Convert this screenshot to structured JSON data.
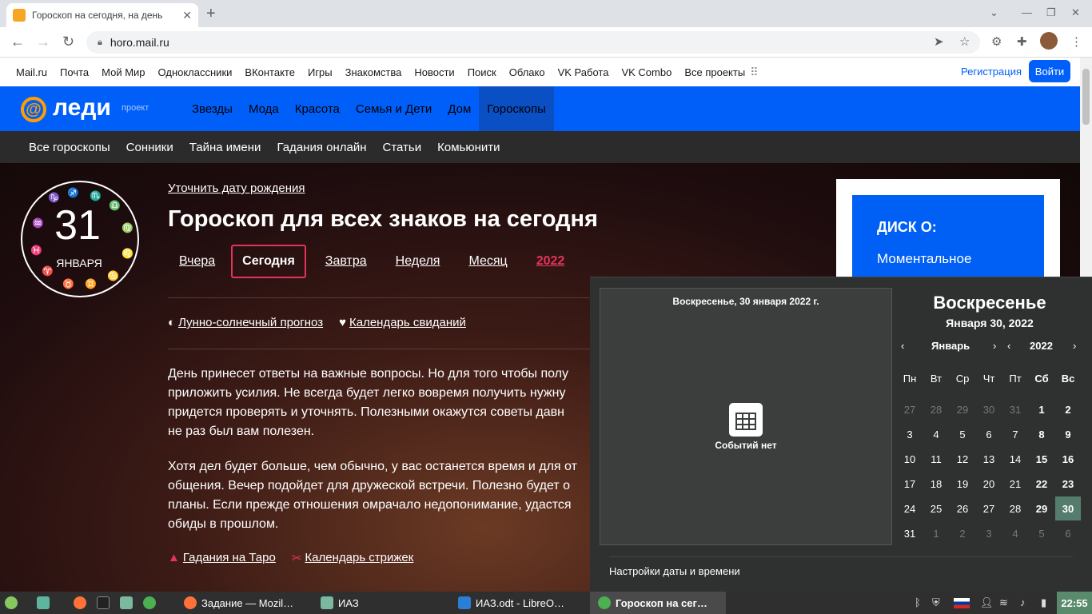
{
  "browser": {
    "tab_title": "Гороскоп на сегодня, на день",
    "url": "horo.mail.ru"
  },
  "portal": {
    "links": [
      "Mail.ru",
      "Почта",
      "Мой Мир",
      "Одноклассники",
      "ВКонтакте",
      "Игры",
      "Знакомства",
      "Новости",
      "Поиск",
      "Облако",
      "VK Работа",
      "VK Combo",
      "Все проекты"
    ],
    "register": "Регистрация",
    "login": "Войти"
  },
  "lady": {
    "logo_text": "леди",
    "logo_sub": "проект",
    "nav": [
      "Звезды",
      "Мода",
      "Красота",
      "Семья и Дети",
      "Дом",
      "Гороскопы"
    ],
    "subnav": [
      "Все гороскопы",
      "Сонники",
      "Тайна имени",
      "Гадания онлайн",
      "Статьи",
      "Комьюнити"
    ]
  },
  "dial": {
    "day": "31",
    "month": "ЯНВАРЯ",
    "zodiac": [
      "♑",
      "♐",
      "♏",
      "♎",
      "♍",
      "♌",
      "♋",
      "♊",
      "♉",
      "♈",
      "♓",
      "♒"
    ]
  },
  "content": {
    "refine_date": "Уточнить дату рождения",
    "title": "Гороскоп для всех знаков на сегодня",
    "periods": [
      "Вчера",
      "Сегодня",
      "Завтра",
      "Неделя",
      "Месяц",
      "2022"
    ],
    "moon_link": "Лунно-солнечный прогноз",
    "dates_link": "Календарь свиданий",
    "para1": "День принесет ответы на важные вопросы. Но для того чтобы полу\nприложить усилия. Не всегда будет легко вовремя получить нужну\nпридется проверять и уточнять. Полезными окажутся советы давн\nне раз был вам полезен.",
    "para2": "Хотя дел будет больше, чем обычно, у вас останется время и для от\nобщения. Вечер подойдет для дружеской встречи. Полезно будет о\nпланы. Если прежде отношения омрачало недопонимание, удастся\nобиды в прошлом.",
    "tarot_link": "Гадания на Таро",
    "haircut_link": "Календарь стрижек"
  },
  "ad": {
    "logo": "ДИСК О:",
    "text": "Моментальное"
  },
  "calendar": {
    "event_date": "Воскресенье, 30 января 2022 г.",
    "no_events": "Событий нет",
    "weekday": "Воскресенье",
    "date": "Января 30, 2022",
    "month": "Январь",
    "year": "2022",
    "dow": [
      "Пн",
      "Вт",
      "Ср",
      "Чт",
      "Пт",
      "Сб",
      "Вс"
    ],
    "weeks": [
      [
        "27",
        "28",
        "29",
        "30",
        "31",
        "1",
        "2"
      ],
      [
        "3",
        "4",
        "5",
        "6",
        "7",
        "8",
        "9"
      ],
      [
        "10",
        "11",
        "12",
        "13",
        "14",
        "15",
        "16"
      ],
      [
        "17",
        "18",
        "19",
        "20",
        "21",
        "22",
        "23"
      ],
      [
        "24",
        "25",
        "26",
        "27",
        "28",
        "29",
        "30"
      ],
      [
        "31",
        "1",
        "2",
        "3",
        "4",
        "5",
        "6"
      ]
    ],
    "settings": "Настройки даты и времени"
  },
  "taskbar": {
    "items": [
      "Задание — Mozil…",
      "ИАЗ",
      "ИАЗ.odt - LibreO…",
      "Гороскоп на сег…"
    ],
    "clock": "22:55"
  }
}
